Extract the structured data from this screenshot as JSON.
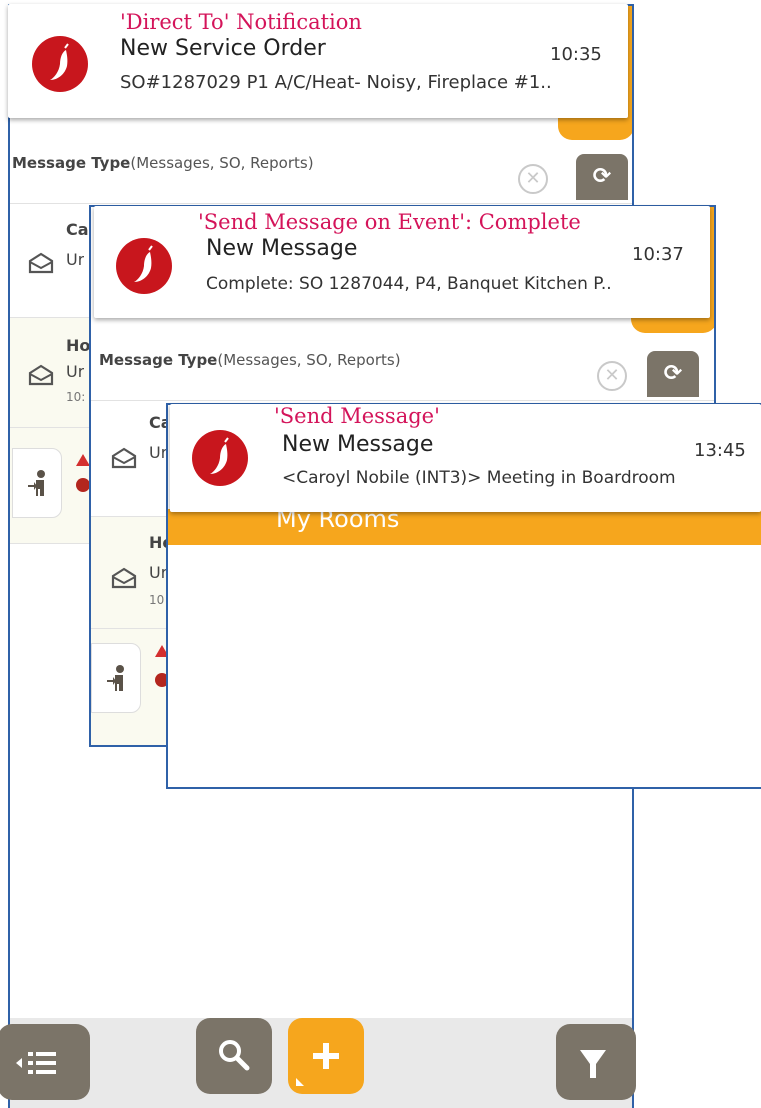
{
  "colors": {
    "accent_orange": "#f6a61d",
    "notif_label": "#d4145a",
    "brand_red": "#c8161d",
    "frame_blue": "#2f61a8",
    "button_taupe": "#7b7468"
  },
  "notifications": [
    {
      "label": "'Direct To' Notification",
      "title": "New Service Order",
      "time": "10:35",
      "body": "SO#1287029 P1 A/C/Heat- Noisy, Fireplace #1.."
    },
    {
      "label": "'Send Message on Event': Complete",
      "title": "New Message",
      "time": "10:37",
      "body": "Complete: SO 1287044, P4, Banquet Kitchen P.."
    },
    {
      "label": "'Send Message'",
      "title": "New Message",
      "time": "13:45",
      "body": "<Caroyl Nobile (INT3)> Meeting in Boardroom"
    }
  ],
  "message_filter": {
    "label_bold": "Message Type",
    "label_rest": "(Messages, SO, Reports)"
  },
  "partial_rows": {
    "r1_a": "Ca",
    "r1_b": "Ur",
    "r2_a": "Ho",
    "r2_b": "Ur",
    "r2_c": "10:",
    "s2_r1_a": "Ca",
    "s2_r1_b": "Ur",
    "s2_r2_a": "Ho",
    "s2_r2_b": "Ur",
    "s2_r2_c": "10"
  },
  "header": {
    "title": "My Rooms"
  },
  "icons": {
    "app": "chili-pepper-logo-icon",
    "clear": "clear-x-icon",
    "refresh": "refresh-icon",
    "envelope": "open-envelope-icon",
    "person": "person-walking-icon",
    "alert": "warning-triangle-icon",
    "menu": "list-menu-icon",
    "search": "search-icon",
    "add": "plus-icon",
    "filter": "filter-icon"
  }
}
